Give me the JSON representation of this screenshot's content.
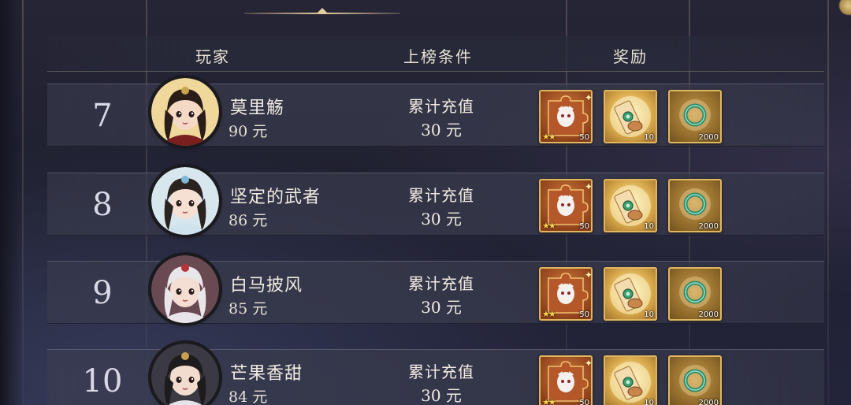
{
  "header": {
    "col_player": "玩家",
    "col_condition": "上榜条件",
    "col_reward": "奖励"
  },
  "rows": [
    {
      "rank": "7",
      "name": "莫里觞",
      "amount": "90 元",
      "condition_line1": "累计充值",
      "condition_line2": "30 元",
      "rewards": [
        {
          "icon": "puzzle-fragment-icon",
          "count": "50",
          "stars": "★★"
        },
        {
          "icon": "scroll-icon",
          "count": "10"
        },
        {
          "icon": "jade-ring-icon",
          "count": "2000"
        }
      ]
    },
    {
      "rank": "8",
      "name": "坚定的武者",
      "amount": "86 元",
      "condition_line1": "累计充值",
      "condition_line2": "30 元",
      "rewards": [
        {
          "icon": "puzzle-fragment-icon",
          "count": "50",
          "stars": "★★"
        },
        {
          "icon": "scroll-icon",
          "count": "10"
        },
        {
          "icon": "jade-ring-icon",
          "count": "2000"
        }
      ]
    },
    {
      "rank": "9",
      "name": "白马披风",
      "amount": "85 元",
      "condition_line1": "累计充值",
      "condition_line2": "30 元",
      "rewards": [
        {
          "icon": "puzzle-fragment-icon",
          "count": "50",
          "stars": "★★"
        },
        {
          "icon": "scroll-icon",
          "count": "10"
        },
        {
          "icon": "jade-ring-icon",
          "count": "2000"
        }
      ]
    },
    {
      "rank": "10",
      "name": "芒果香甜",
      "amount": "84 元",
      "condition_line1": "累计充值",
      "condition_line2": "30 元",
      "rewards": [
        {
          "icon": "puzzle-fragment-icon",
          "count": "50",
          "stars": "★★"
        },
        {
          "icon": "scroll-icon",
          "count": "10"
        },
        {
          "icon": "jade-ring-icon",
          "count": "2000"
        }
      ]
    }
  ],
  "colors": {
    "accent": "#e4cf9c",
    "frame_gold": "#e0b660",
    "text": "#f1ece2"
  }
}
